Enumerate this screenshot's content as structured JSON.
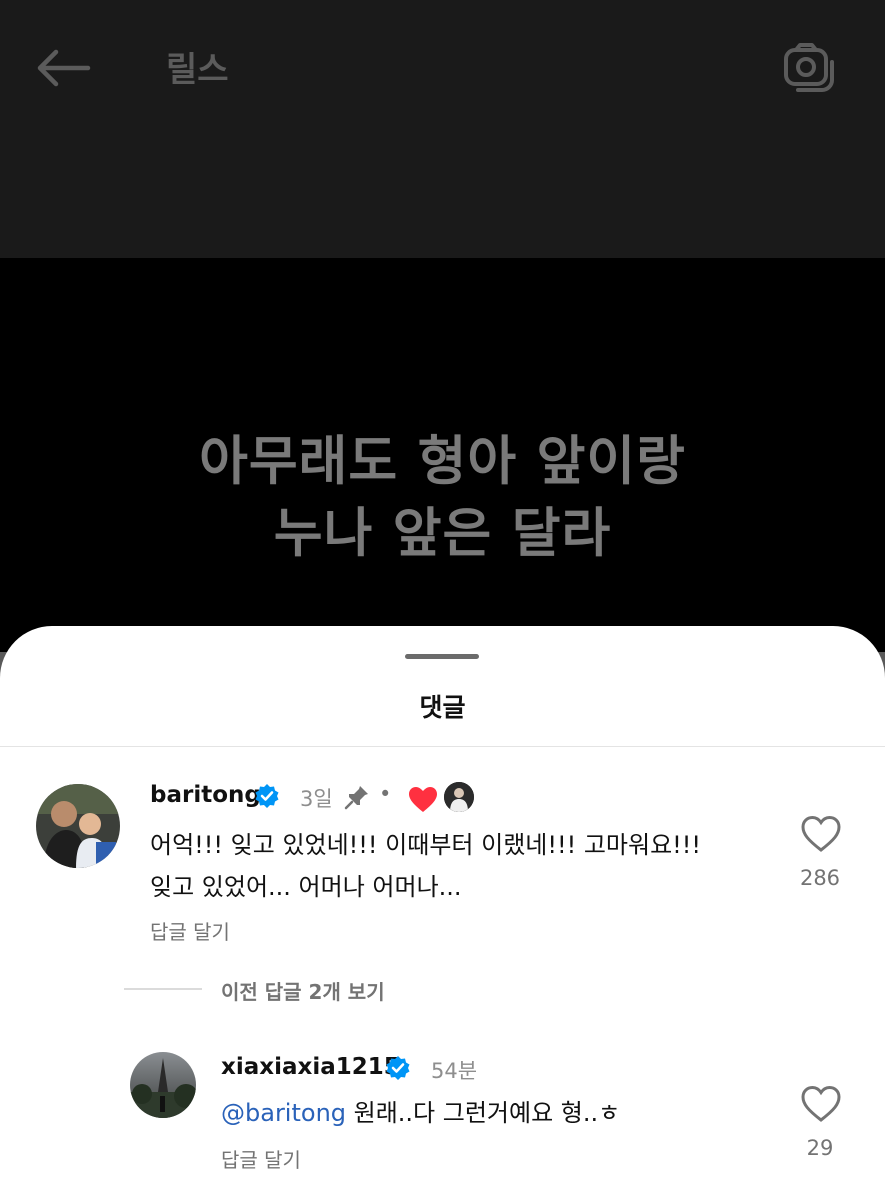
{
  "header": {
    "title": "릴스",
    "back_icon": "arrow-left-icon",
    "camera_icon": "camera-icon"
  },
  "video": {
    "caption_line1": "아무래도 형아 앞이랑",
    "caption_line2": "누나 앞은 달라"
  },
  "comments_sheet": {
    "title": "댓글",
    "comments": [
      {
        "username": "baritong",
        "verified": true,
        "time": "3일",
        "pinned": true,
        "separator": "•",
        "liked_by_author": true,
        "text_line1": "어억!!! 잊고 있었네!!! 이때부터 이랬네!!! 고마워요!!!",
        "text_line2": "잊고 있었어... 어머나 어머나...",
        "reply_label": "답글 달기",
        "like_count": "286"
      }
    ],
    "view_replies_label": "이전 답글 2개 보기",
    "replies": [
      {
        "username": "xiaxiaxia1215",
        "verified": true,
        "time": "54분",
        "mention": "@baritong",
        "text": " 원래..다 그런거예요 형..ㅎ",
        "reply_label": "답글 달기",
        "like_count": "29"
      }
    ]
  },
  "colors": {
    "verified_blue": "#0095f6",
    "heart_red": "#ff3040",
    "mention_blue": "#2a62b9"
  }
}
